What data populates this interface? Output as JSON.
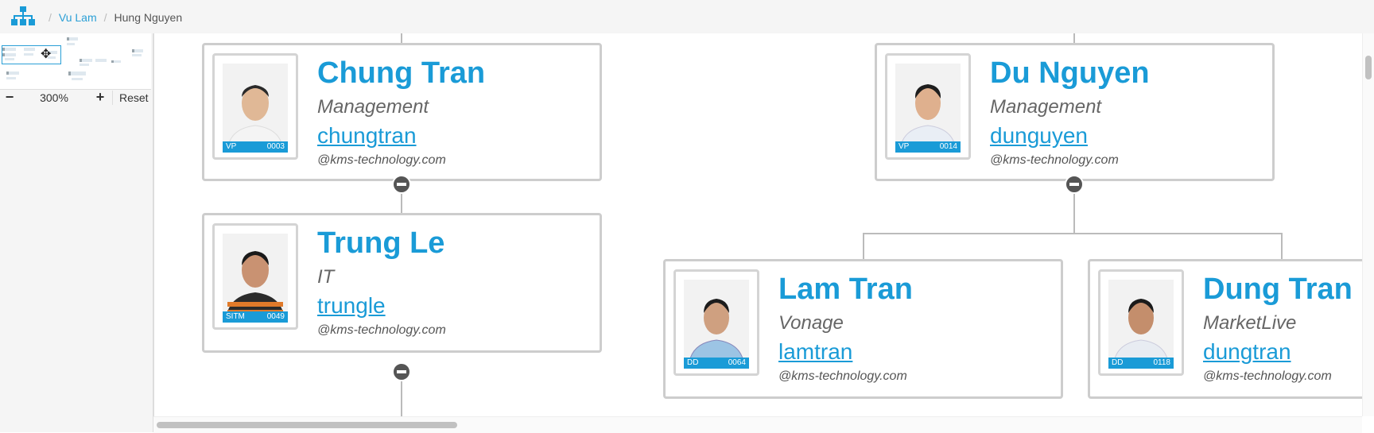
{
  "breadcrumb": {
    "home_icon": "org-chart-icon",
    "separator": "/",
    "items": [
      {
        "label": "Vu Lam",
        "link": true
      },
      {
        "label": "Hung Nguyen",
        "link": false
      }
    ]
  },
  "navigator": {
    "zoom_out_icon": "minus-icon",
    "zoom_level": "300%",
    "zoom_in_icon": "plus-icon",
    "reset_label": "Reset",
    "move_icon": "move-icon"
  },
  "colors": {
    "accent": "#1a9bd7",
    "card_border": "#cdcdcd",
    "toggle": "#555555"
  },
  "cards": [
    {
      "name": "Chung Tran",
      "department": "Management",
      "username": "chungtran",
      "domain": "@kms-technology.com",
      "grade": "VP",
      "employee_id": "0003",
      "collapse_icon": "collapse-icon"
    },
    {
      "name": "Du Nguyen",
      "department": "Management",
      "username": "dunguyen",
      "domain": "@kms-technology.com",
      "grade": "VP",
      "employee_id": "0014",
      "collapse_icon": "collapse-icon"
    },
    {
      "name": "Trung Le",
      "department": "IT",
      "username": "trungle",
      "domain": "@kms-technology.com",
      "grade": "SITM",
      "employee_id": "0049",
      "collapse_icon": "collapse-icon"
    },
    {
      "name": "Lam Tran",
      "department": "Vonage",
      "username": "lamtran",
      "domain": "@kms-technology.com",
      "grade": "DD",
      "employee_id": "0064",
      "collapse_icon": "collapse-icon"
    },
    {
      "name": "Dung Tran",
      "department": "MarketLive",
      "username": "dungtran",
      "domain": "@kms-technology.com",
      "grade": "DD",
      "employee_id": "0118",
      "collapse_icon": "collapse-icon"
    }
  ]
}
